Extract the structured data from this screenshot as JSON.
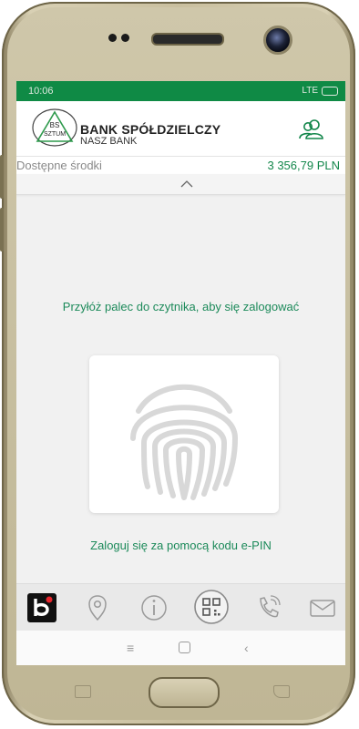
{
  "status_bar": {
    "time": "10:06",
    "network": "LTE"
  },
  "header": {
    "logo_text_top": "BS",
    "logo_text_bottom": "SZTUM",
    "bank_name": "BANK SPÓŁDZIELCZY",
    "bank_sub": "NASZ BANK",
    "profile_icon": "users-icon"
  },
  "balance": {
    "label": "Dostępne środki",
    "value": "3 356,79 PLN"
  },
  "main": {
    "prompt": "Przyłóż palec do czytnika, aby się zalogować",
    "fingerprint_icon": "fingerprint-icon",
    "epin_link": "Zaloguj się za pomocą kodu e-PIN"
  },
  "bottom_nav": {
    "items": [
      {
        "icon": "blik-icon"
      },
      {
        "icon": "location-pin-icon"
      },
      {
        "icon": "info-icon"
      },
      {
        "icon": "qr-code-icon"
      },
      {
        "icon": "phone-icon"
      },
      {
        "icon": "mail-icon"
      }
    ]
  },
  "colors": {
    "accent": "#0f8a45",
    "accent_text": "#1c8a5a",
    "nav_bg": "#e9e9e9"
  }
}
